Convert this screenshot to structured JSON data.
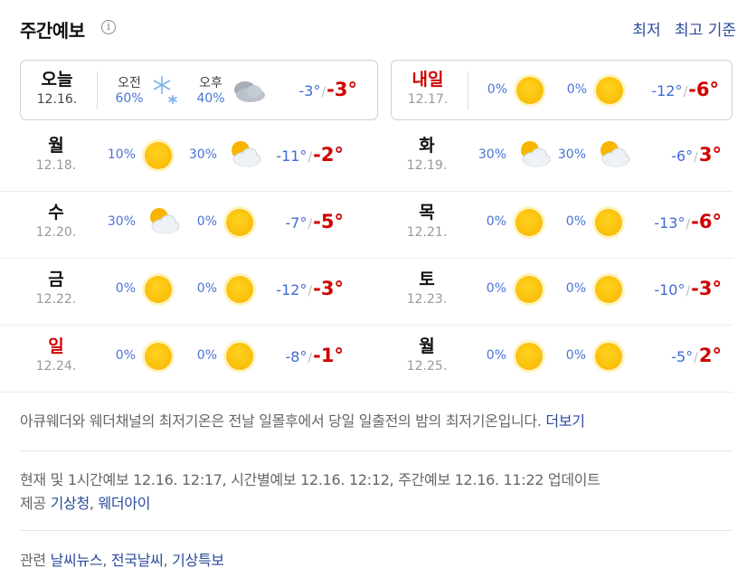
{
  "header": {
    "title": "주간예보",
    "sort_low": "최저",
    "sort_high": "최고 기준"
  },
  "today": {
    "name": "오늘",
    "date": "12.16.",
    "am_label": "오전",
    "am_rain": "60%",
    "pm_label": "오후",
    "pm_rain": "40%",
    "low": "-3°",
    "high": "-3°"
  },
  "tomorrow": {
    "name": "내일",
    "date": "12.17.",
    "am_rain": "0%",
    "pm_rain": "0%",
    "low": "-12°",
    "high": "-6°"
  },
  "days": [
    {
      "name": "월",
      "date": "12.18.",
      "am_rain": "10%",
      "pm_rain": "30%",
      "low": "-11°",
      "high": "-2°",
      "am_icon": "sun-icon",
      "pm_icon": "partly-cloudy-icon"
    },
    {
      "name": "화",
      "date": "12.19.",
      "am_rain": "30%",
      "pm_rain": "30%",
      "low": "-6°",
      "high": "3°",
      "am_icon": "partly-cloudy-icon",
      "pm_icon": "partly-cloudy-icon"
    },
    {
      "name": "수",
      "date": "12.20.",
      "am_rain": "30%",
      "pm_rain": "0%",
      "low": "-7°",
      "high": "-5°",
      "am_icon": "partly-cloudy-icon",
      "pm_icon": "sun-icon"
    },
    {
      "name": "목",
      "date": "12.21.",
      "am_rain": "0%",
      "pm_rain": "0%",
      "low": "-13°",
      "high": "-6°",
      "am_icon": "sun-icon",
      "pm_icon": "sun-icon"
    },
    {
      "name": "금",
      "date": "12.22.",
      "am_rain": "0%",
      "pm_rain": "0%",
      "low": "-12°",
      "high": "-3°",
      "am_icon": "sun-icon",
      "pm_icon": "sun-icon"
    },
    {
      "name": "토",
      "date": "12.23.",
      "am_rain": "0%",
      "pm_rain": "0%",
      "low": "-10°",
      "high": "-3°",
      "am_icon": "sun-icon",
      "pm_icon": "sun-icon"
    },
    {
      "name": "일",
      "date": "12.24.",
      "am_rain": "0%",
      "pm_rain": "0%",
      "low": "-8°",
      "high": "-1°",
      "am_icon": "sun-icon",
      "pm_icon": "sun-icon"
    },
    {
      "name": "월",
      "date": "12.25.",
      "am_rain": "0%",
      "pm_rain": "0%",
      "low": "-5°",
      "high": "2°",
      "am_icon": "sun-icon",
      "pm_icon": "sun-icon"
    }
  ],
  "note": {
    "text": "아큐웨더와 웨더채널의 최저기온은 전날 일몰후에서 당일 일출전의 밤의 최저기온입니다. ",
    "more": "더보기"
  },
  "update": {
    "text": "현재 및 1시간예보 12.16. 12:17, 시간별예보 12.16. 12:12, 주간예보 12.16. 11:22 업데이트",
    "provider_label": "제공 ",
    "provider_1": "기상청",
    "provider_sep": ", ",
    "provider_2": "웨더아이"
  },
  "related": {
    "label": "관련 ",
    "link_1": "날씨뉴스",
    "sep_1": ", ",
    "link_2": "전국날씨",
    "sep_2": ", ",
    "link_3": "기상특보"
  },
  "colors": {
    "link": "#2b4a9c",
    "rain": "#4a74d6",
    "low": "#3e69d6",
    "high": "#d10000"
  }
}
